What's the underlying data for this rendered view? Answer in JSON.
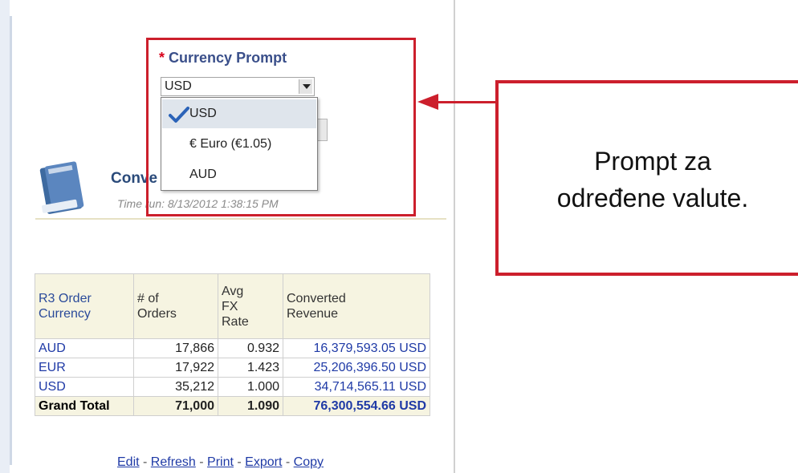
{
  "prompt": {
    "required_marker": "*",
    "label": "Currency Prompt",
    "selected_value": "USD",
    "options": [
      {
        "label": "USD",
        "selected": true
      },
      {
        "label": "€ Euro (€1.05)",
        "selected": false
      },
      {
        "label": "AUD",
        "selected": false
      }
    ]
  },
  "report": {
    "title": "Conve",
    "time_run": "Time run: 8/13/2012 1:38:15 PM"
  },
  "callout": {
    "line1": "Prompt za",
    "line2": "određene valute."
  },
  "table": {
    "headers": [
      [
        "R3 Order",
        "Currency"
      ],
      [
        "# of",
        "Orders"
      ],
      [
        "Avg",
        "FX",
        "Rate"
      ],
      [
        "Converted",
        "Revenue"
      ]
    ],
    "rows": [
      {
        "currency": "AUD",
        "orders": "17,866",
        "rate": "0.932",
        "revenue": "16,379,593.05 USD"
      },
      {
        "currency": "EUR",
        "orders": "17,922",
        "rate": "1.423",
        "revenue": "25,206,396.50 USD"
      },
      {
        "currency": "USD",
        "orders": "35,212",
        "rate": "1.000",
        "revenue": "34,714,565.11 USD"
      }
    ],
    "total": {
      "label": "Grand Total",
      "orders": "71,000",
      "rate": "1.090",
      "revenue": "76,300,554.66 USD"
    }
  },
  "links": {
    "edit": "Edit",
    "refresh": "Refresh",
    "print": "Print",
    "export": "Export",
    "copy": "Copy",
    "separator": " - "
  },
  "colors": {
    "highlight_red": "#cc1f2c",
    "link_blue": "#1f3aa6",
    "header_beige": "#f6f4e1"
  },
  "icons": {
    "report": "book-icon",
    "selected_option": "checkmark-icon",
    "dropdown": "chevron-down-icon"
  }
}
